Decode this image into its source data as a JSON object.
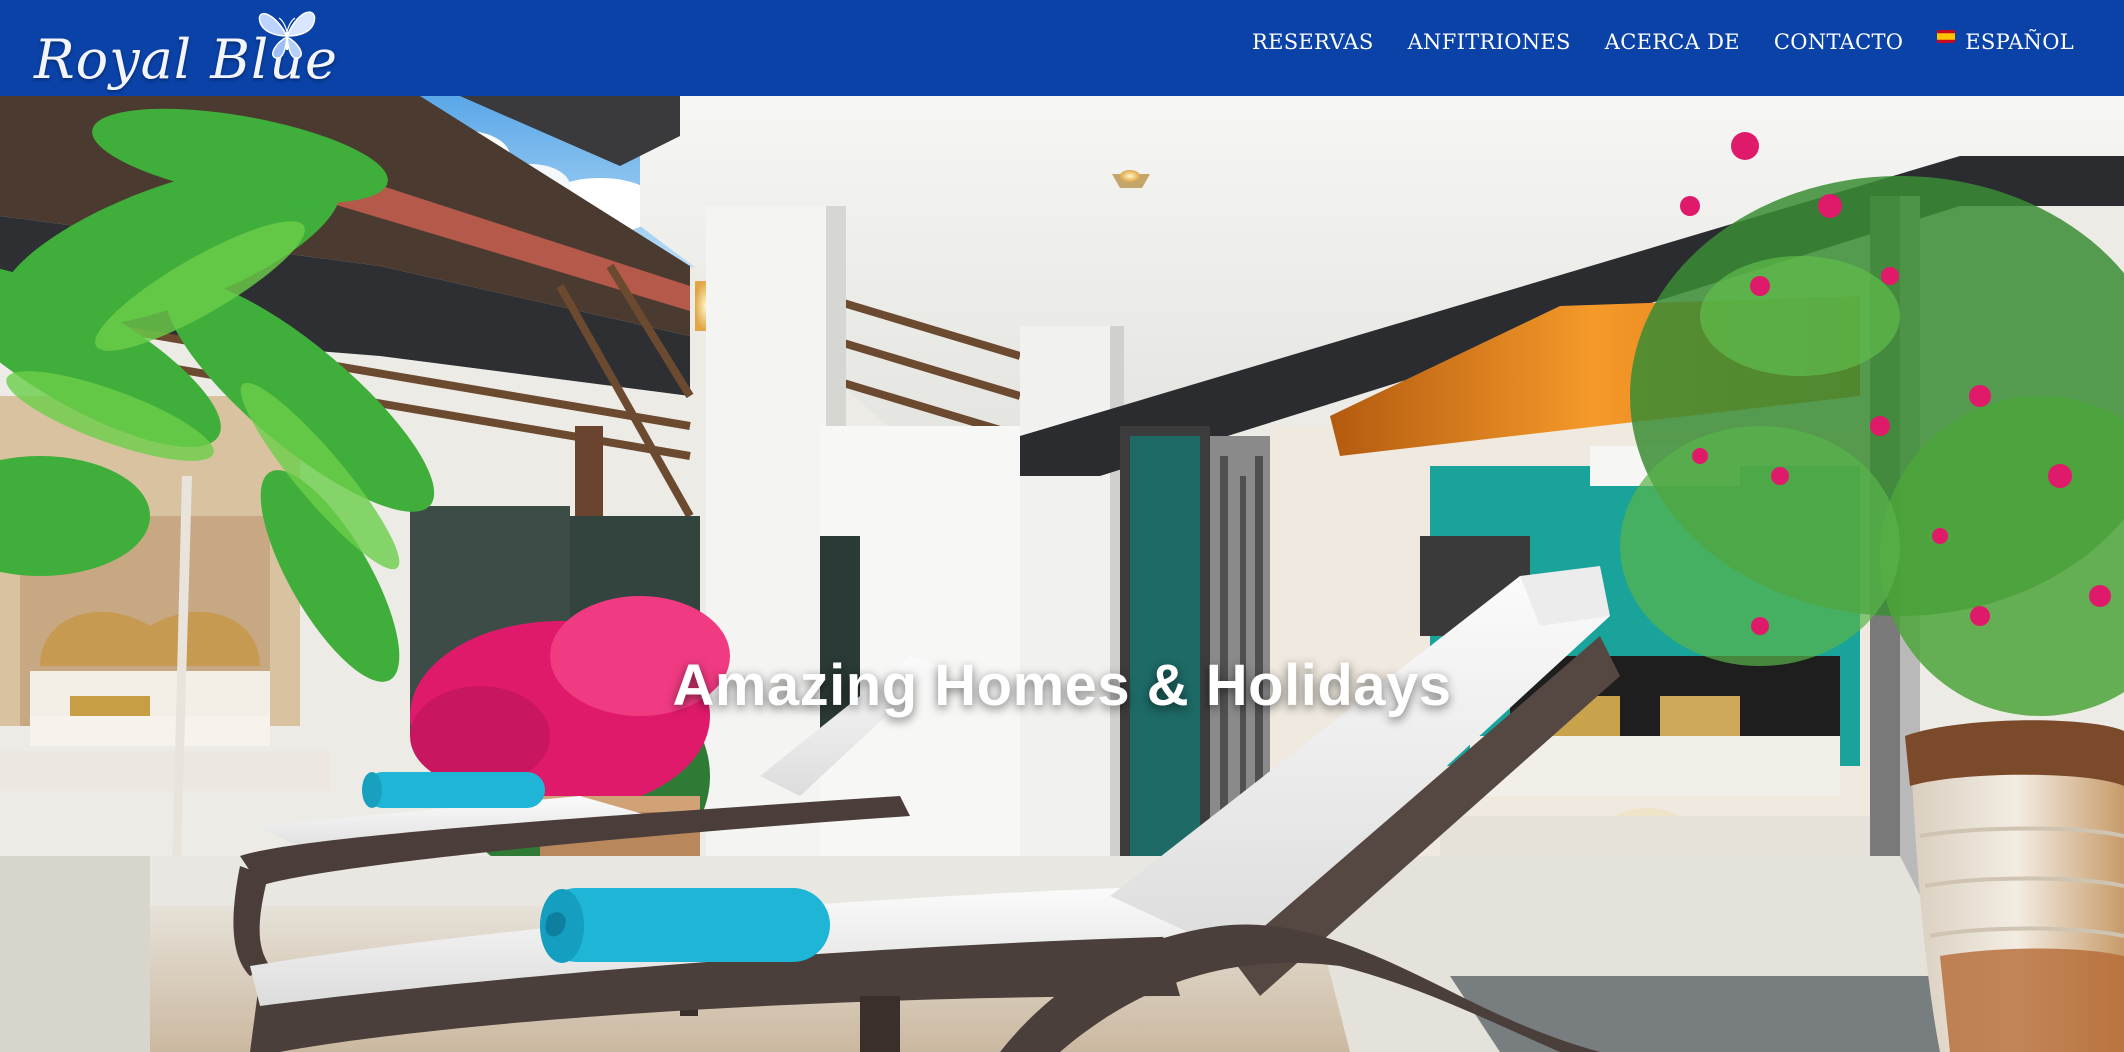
{
  "brand": {
    "logo_text": "Royal Blue",
    "logo_icon": "butterfly-icon"
  },
  "nav": {
    "items": [
      {
        "label": "RESERVAS"
      },
      {
        "label": "ANFITRIONES"
      },
      {
        "label": "ACERCA DE"
      },
      {
        "label": "CONTACTO"
      }
    ],
    "language": {
      "label": "ESPAÑOL",
      "icon": "spain-flag-icon"
    }
  },
  "hero": {
    "title": "Amazing Homes & Holidays",
    "image": "pool-terrace-with-sun-loungers"
  },
  "colors": {
    "header_bg": "#0a42a8",
    "nav_text": "#ffffff",
    "towel": "#1fb5d6",
    "accent_teal": "#1aa39a",
    "bougainvillea": "#e01a6a"
  }
}
